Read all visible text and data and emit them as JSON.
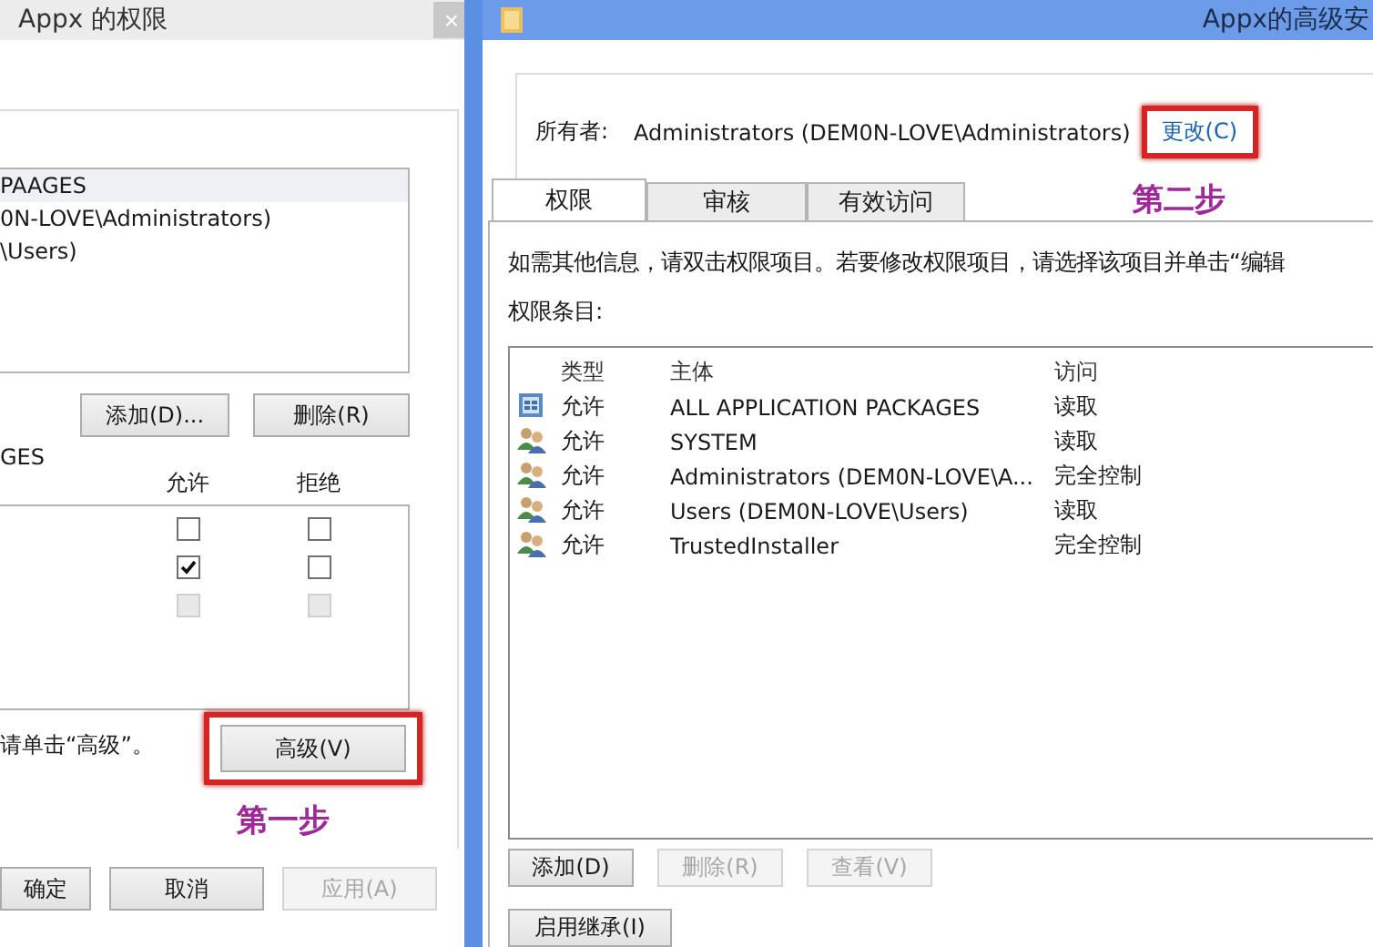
{
  "left_window": {
    "title": "Appx 的权限",
    "close": "×",
    "groups": [
      {
        "label": "PAAGES",
        "selected": true
      },
      {
        "label": "0N-LOVE\\Administrators)",
        "selected": false
      },
      {
        "label": "\\Users)",
        "selected": false
      }
    ],
    "group_buttons": [
      {
        "label": "添加(D)...",
        "disabled": false
      },
      {
        "label": "删除(R)",
        "disabled": false
      }
    ],
    "permissions_label": "GES",
    "permission_columns": [
      "允许",
      "拒绝"
    ],
    "permission_rows": [
      {
        "allow": {
          "checked": false,
          "disabled": false
        },
        "deny": {
          "checked": false,
          "disabled": false
        }
      },
      {
        "allow": {
          "checked": true,
          "disabled": false
        },
        "deny": {
          "checked": false,
          "disabled": false
        }
      },
      {
        "allow": {
          "checked": false,
          "disabled": true
        },
        "deny": {
          "checked": false,
          "disabled": true
        }
      }
    ],
    "advanced_hint": "请单击“高级”。",
    "advanced_button": "高级(V)",
    "annotation": "第一步",
    "buttons": [
      {
        "label": "确定",
        "disabled": false
      },
      {
        "label": "取消",
        "disabled": false
      },
      {
        "label": "应用(A)",
        "disabled": true
      }
    ]
  },
  "right_window": {
    "title": "Appx的高级安",
    "owner_label": "所有者:",
    "owner": "Administrators (DEM0N-LOVE\\Administrators)",
    "change_link": "更改(C)",
    "tabs": [
      {
        "label": "权限",
        "selected": true
      },
      {
        "label": "审核",
        "selected": false
      },
      {
        "label": "有效访问",
        "selected": false
      }
    ],
    "annotation": "第二步",
    "info": "如需其他信息，请双击权限项目。若要修改权限项目，请选择该项目并单击“编辑",
    "entries_label": "权限条目:",
    "table": {
      "columns": [
        "类型",
        "主体",
        "访问"
      ],
      "rows": [
        {
          "kind": "package",
          "type": "允许",
          "principal": "ALL APPLICATION PACKAGES",
          "access": "读取"
        },
        {
          "kind": "group",
          "type": "允许",
          "principal": "SYSTEM",
          "access": "读取"
        },
        {
          "kind": "group",
          "type": "允许",
          "principal": "Administrators (DEM0N-LOVE\\A...",
          "access": "完全控制"
        },
        {
          "kind": "group",
          "type": "允许",
          "principal": "Users (DEM0N-LOVE\\Users)",
          "access": "读取"
        },
        {
          "kind": "group",
          "type": "允许",
          "principal": "TrustedInstaller",
          "access": "完全控制"
        }
      ]
    },
    "buttons": [
      {
        "label": "添加(D)",
        "disabled": false
      },
      {
        "label": "删除(R)",
        "disabled": true
      },
      {
        "label": "查看(V)",
        "disabled": true
      }
    ],
    "inherit_button": "启用继承(I)"
  }
}
